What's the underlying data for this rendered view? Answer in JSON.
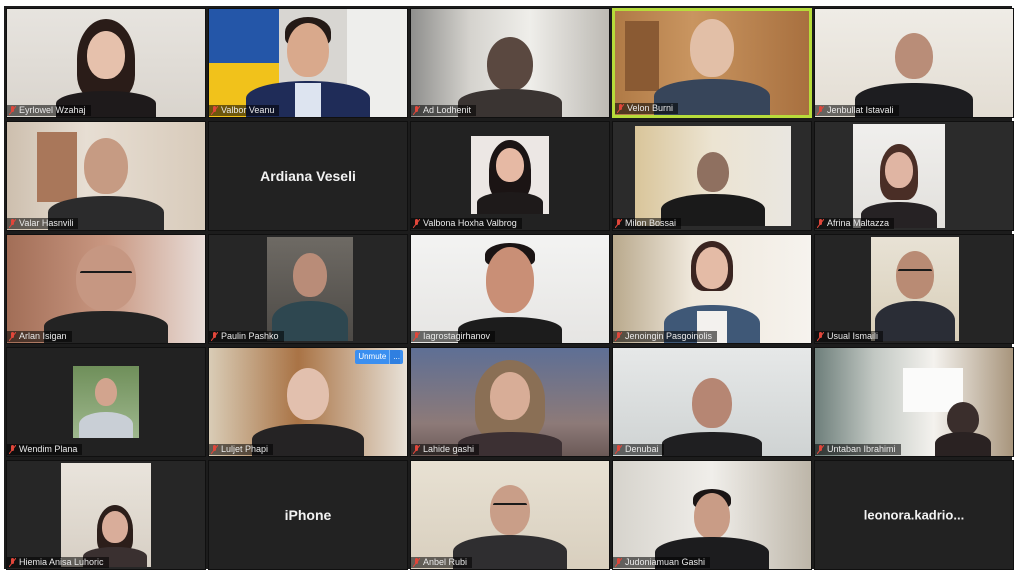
{
  "meeting": {
    "participants": [
      {
        "name": "Eyrlowel Wzahaj",
        "video": true
      },
      {
        "name": "Valbor Veanu",
        "video": true
      },
      {
        "name": "Ad Lodhenit",
        "video": true
      },
      {
        "name": "Velon Burni",
        "video": true,
        "active_speaker": true
      },
      {
        "name": "Jenbullat Istavali",
        "video": true
      },
      {
        "name": "Valar Hasnvili",
        "video": true
      },
      {
        "name": "Ardiana Veseli",
        "video": false
      },
      {
        "name": "Valbona Hoxha Valbrog",
        "video": true
      },
      {
        "name": "Milon Bossai",
        "video": true
      },
      {
        "name": "Afrina Maltazza",
        "video": true
      },
      {
        "name": "Arlan Isigan",
        "video": true
      },
      {
        "name": "Paulin Pashko",
        "video": true
      },
      {
        "name": "Iagrostagirhanov",
        "video": true
      },
      {
        "name": "Jenoingin Pasgoinolis",
        "video": true
      },
      {
        "name": "Usual Ismaili",
        "video": true
      },
      {
        "name": "Wendim Plana",
        "video": true
      },
      {
        "name": "Luljet Phapi",
        "video": true,
        "badge": "Unmute",
        "badge_more": "..."
      },
      {
        "name": "Lahide gashi",
        "video": true
      },
      {
        "name": "Denubai",
        "video": true
      },
      {
        "name": "Untaban Ibrahimi",
        "video": true
      },
      {
        "name": "Hiemia Anisa Luhoric",
        "video": true
      },
      {
        "name": "iPhone",
        "video": false,
        "no_tag": true
      },
      {
        "name": "Anbel Rubi",
        "video": true
      },
      {
        "name": "Judoniamuan Gashi",
        "video": true
      },
      {
        "name": "leonora.kadrio...",
        "video": false,
        "no_tag": true
      }
    ]
  },
  "colors": {
    "active_speaker_border": "#b7dc3a",
    "muted_icon": "#e0463a",
    "badge": "#3b8ff0"
  }
}
